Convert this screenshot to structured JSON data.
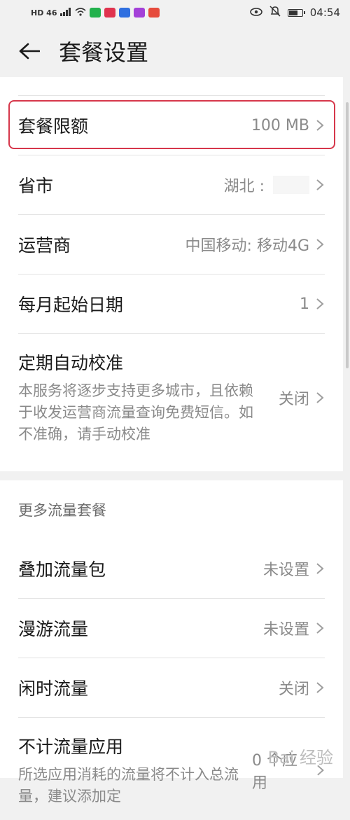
{
  "status_bar": {
    "network": "HD 46",
    "time": "04:54",
    "battery_level": 0.75
  },
  "header": {
    "title": "套餐设置"
  },
  "settings": [
    {
      "label": "套餐限额",
      "value": "100 MB"
    },
    {
      "label": "省市",
      "value": "湖北 :"
    },
    {
      "label": "运营商",
      "value": "中国移动: 移动4G"
    },
    {
      "label": "每月起始日期",
      "value": "1"
    },
    {
      "label": "定期自动校准",
      "desc": "本服务将逐步支持更多城市，且依赖于收发运营商流量查询免费短信。如不准确，请手动校准",
      "value": "关闭"
    }
  ],
  "more_section": {
    "title": "更多流量套餐",
    "items": [
      {
        "label": "叠加流量包",
        "value": "未设置"
      },
      {
        "label": "漫游流量",
        "value": "未设置"
      },
      {
        "label": "闲时流量",
        "value": "关闭"
      },
      {
        "label": "不计流量应用",
        "desc": "所选应用消耗的流量将不计入总流量，建议添加定",
        "value": "0 个应用"
      }
    ]
  },
  "watermark": "Bai 经验"
}
